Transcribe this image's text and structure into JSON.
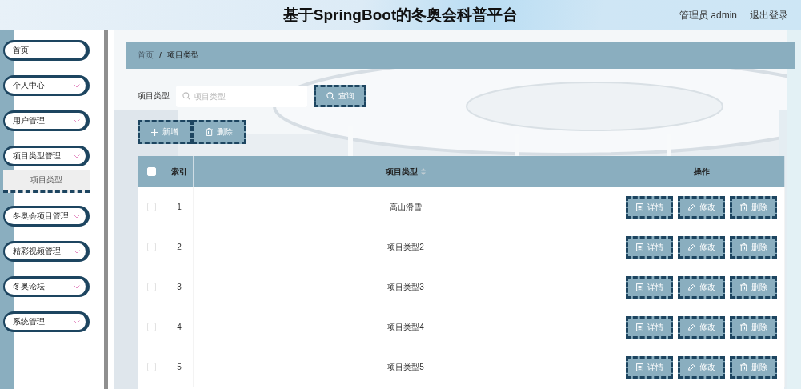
{
  "header": {
    "title": "基于SpringBoot的冬奥会科普平台",
    "user": "管理员 admin",
    "logout": "退出登录"
  },
  "sidebar": {
    "items": [
      {
        "label": "首页",
        "kind": "link"
      },
      {
        "label": "个人中心",
        "kind": "menu"
      },
      {
        "label": "用户管理",
        "kind": "menu"
      },
      {
        "label": "项目类型管理",
        "kind": "menu",
        "children": [
          {
            "label": "项目类型",
            "selected": true
          }
        ]
      },
      {
        "label": "冬奥会项目管理",
        "kind": "menu"
      },
      {
        "label": "精彩视频管理",
        "kind": "menu"
      },
      {
        "label": "冬奥论坛",
        "kind": "menu"
      },
      {
        "label": "系统管理",
        "kind": "menu"
      }
    ]
  },
  "breadcrumb": {
    "items": [
      "首页",
      "项目类型"
    ],
    "separator": "/"
  },
  "search": {
    "label": "项目类型",
    "placeholder": "项目类型",
    "button": "查询"
  },
  "toolbar": [
    {
      "label": "新增",
      "kind": "add"
    },
    {
      "label": "删除",
      "kind": "delete"
    }
  ],
  "table": {
    "select_all": {
      "checked": false
    },
    "columns": [
      {
        "label": "索引"
      },
      {
        "label": "项目类型",
        "sortable": true
      },
      {
        "label": "操作"
      }
    ],
    "rows": [
      {
        "checked": false,
        "index": "1",
        "name": "高山滑雪",
        "actions": [
          {
            "label": "详情",
            "kind": "detail"
          },
          {
            "label": "修改",
            "kind": "edit"
          },
          {
            "label": "删除",
            "kind": "delete"
          }
        ]
      },
      {
        "checked": false,
        "index": "2",
        "name": "项目类型2",
        "actions": [
          {
            "label": "详情",
            "kind": "detail"
          },
          {
            "label": "修改",
            "kind": "edit"
          },
          {
            "label": "删除",
            "kind": "delete"
          }
        ]
      },
      {
        "checked": false,
        "index": "3",
        "name": "项目类型3",
        "actions": [
          {
            "label": "详情",
            "kind": "detail"
          },
          {
            "label": "修改",
            "kind": "edit"
          },
          {
            "label": "删除",
            "kind": "delete"
          }
        ]
      },
      {
        "checked": false,
        "index": "4",
        "name": "项目类型4",
        "actions": [
          {
            "label": "详情",
            "kind": "detail"
          },
          {
            "label": "修改",
            "kind": "edit"
          },
          {
            "label": "删除",
            "kind": "delete"
          }
        ]
      },
      {
        "checked": false,
        "index": "5",
        "name": "项目类型5",
        "actions": [
          {
            "label": "详情",
            "kind": "detail"
          },
          {
            "label": "修改",
            "kind": "edit"
          },
          {
            "label": "删除",
            "kind": "delete"
          }
        ]
      }
    ]
  }
}
